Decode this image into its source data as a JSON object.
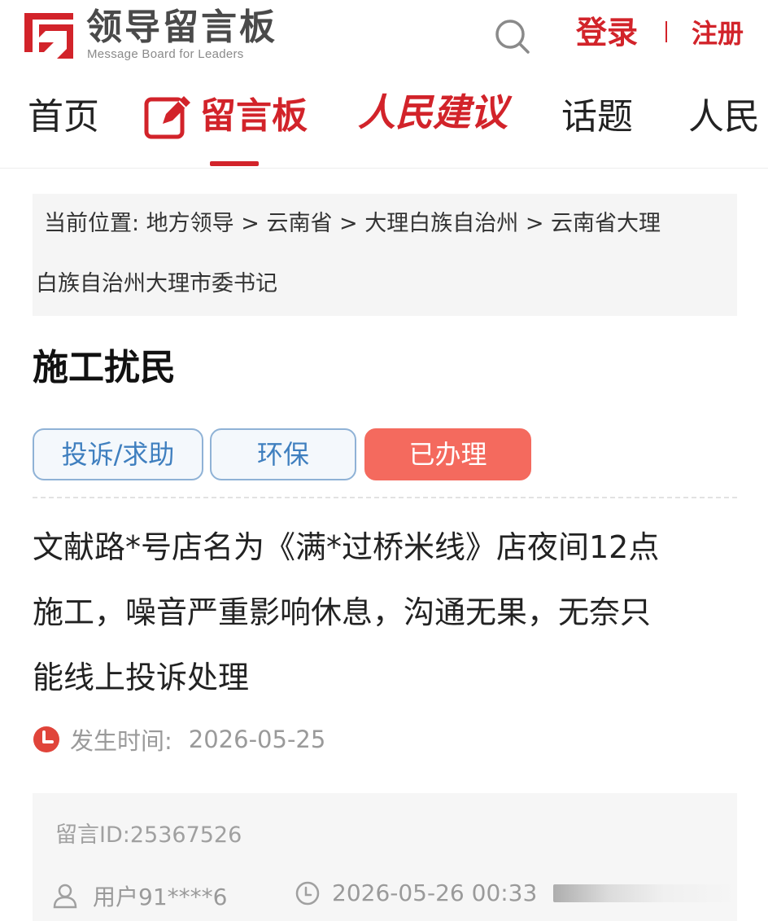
{
  "header": {
    "brand_name": "领导留言板",
    "brand_subtitle": "Message Board for Leaders",
    "login_label": "登录",
    "register_label": "注册"
  },
  "nav": {
    "items": [
      {
        "label": "首页"
      },
      {
        "label": "留言板"
      },
      {
        "label": "人民建议"
      },
      {
        "label": "话题"
      },
      {
        "label": "人民"
      }
    ],
    "active_index": 1
  },
  "breadcrumb": {
    "line1": "当前位置:  地方领导 > 云南省 > 大理白族自治州 > 云南省大理",
    "line2": "白族自治州大理市委书记"
  },
  "message": {
    "title": "施工扰民",
    "tags": {
      "type": "投诉/求助",
      "category": "环保",
      "status": "已办理"
    },
    "content_lines": [
      "文献路*号店名为《满*过桥米线》店夜间12点",
      "施工，噪音严重影响休息，沟通无果，无奈只",
      "能线上投诉处理"
    ],
    "occurred_label": "发生时间:",
    "occurred_date": "2026-05-25"
  },
  "meta": {
    "message_id": "留言ID:25367526",
    "user": "用户91****6",
    "posted_time": "2026-05-26 00:33"
  },
  "colors": {
    "brand_red": "#d2232a",
    "tag_blue": "#3f7fbf",
    "status_red": "#f46a5e"
  }
}
